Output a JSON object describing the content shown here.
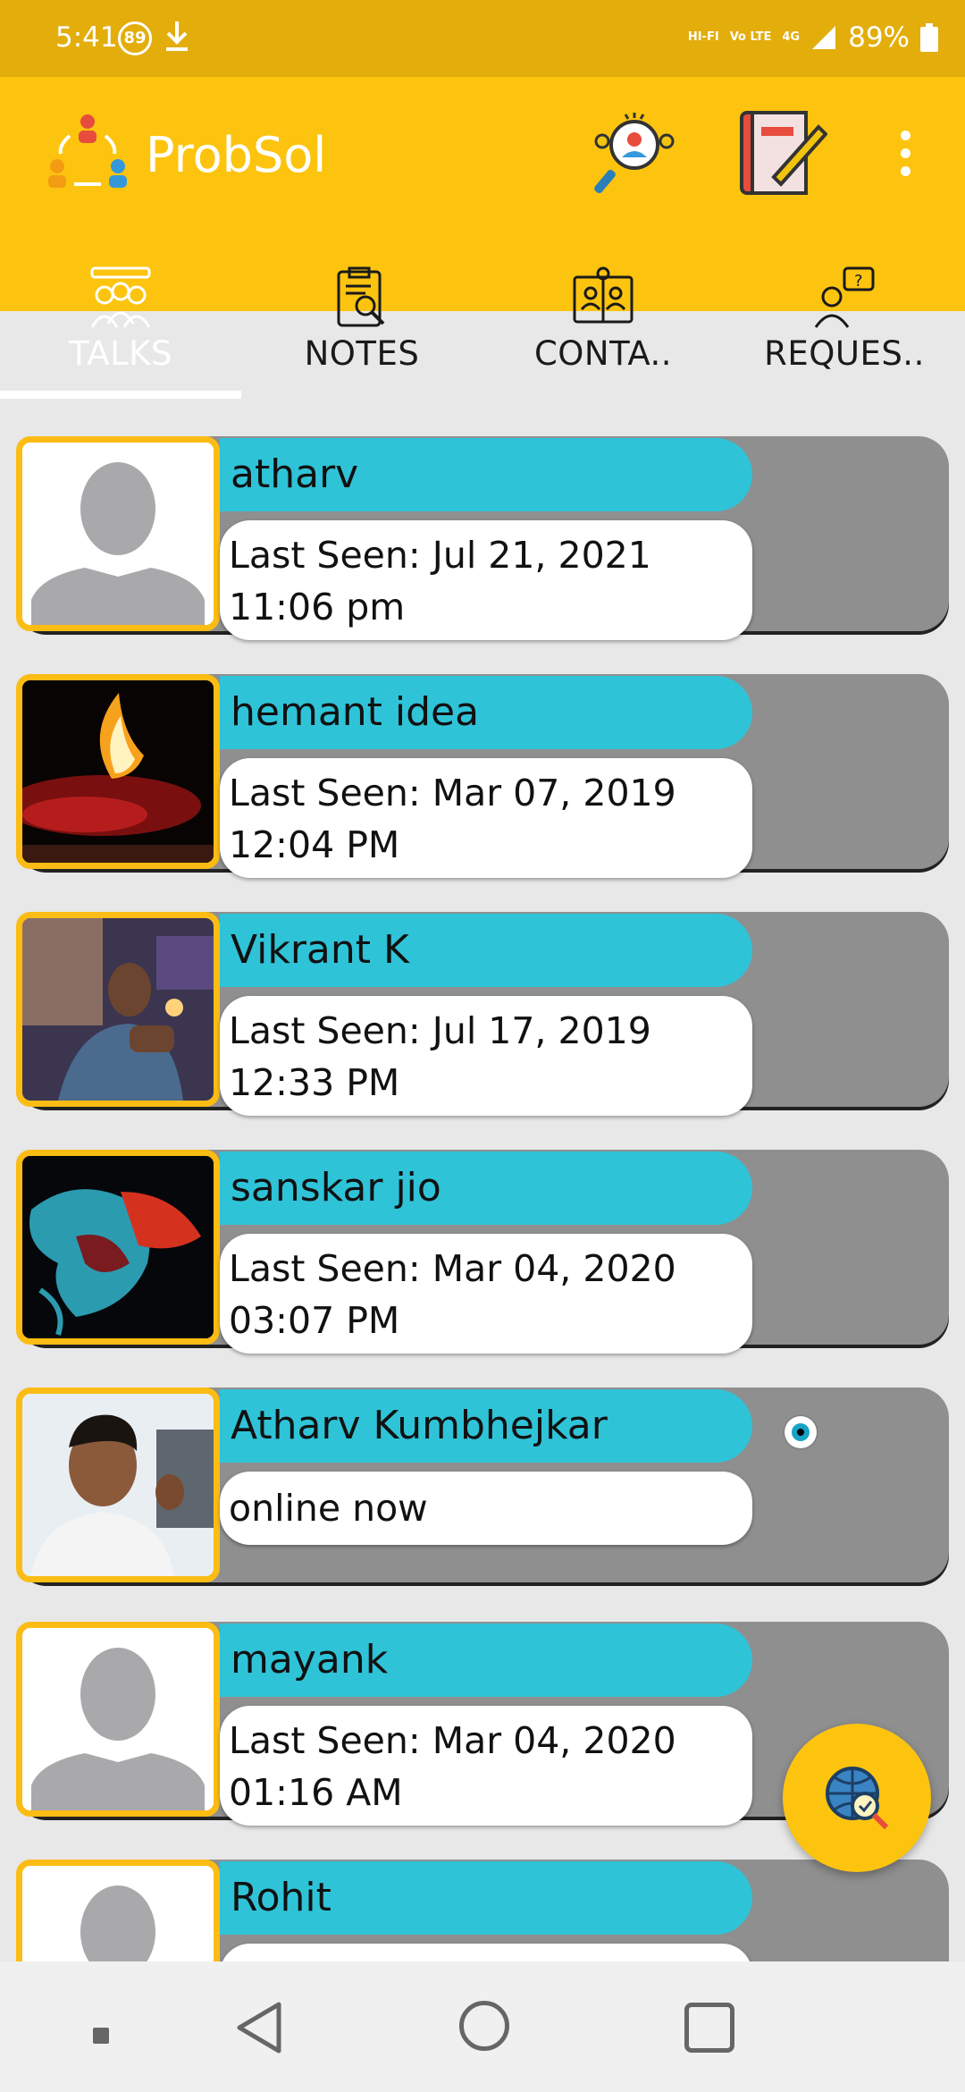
{
  "status_bar": {
    "time": "5:41",
    "notif_badge": "89",
    "hd_label": "HI-FI",
    "volte_label": "Vo LTE",
    "network_label": "4G",
    "battery": "89%"
  },
  "app": {
    "title": "ProbSol",
    "icons": [
      "team-logo-icon",
      "search-user-icon",
      "notes-edit-icon",
      "more-vert-icon"
    ],
    "tabs": [
      {
        "label": "TALKS",
        "active": true,
        "icon": "group-icon"
      },
      {
        "label": "NOTES",
        "active": false,
        "icon": "clipboard-search-icon"
      },
      {
        "label": "CONTA..",
        "active": false,
        "icon": "contacts-book-icon"
      },
      {
        "label": "REQUES..",
        "active": false,
        "icon": "person-question-icon"
      }
    ]
  },
  "chats": [
    {
      "name": "atharv",
      "status": "Last Seen: Jul 21, 2021 11:06 pm",
      "line1": "Last Seen: Jul 21, 2021",
      "line2": "11:06 pm",
      "avatar": "placeholder"
    },
    {
      "name": "hemant idea",
      "status": "Last Seen: Mar 07, 2019 12:04 PM",
      "line1": "Last Seen: Mar 07, 2019",
      "line2": "12:04 PM",
      "avatar": "diya-lamp"
    },
    {
      "name": "Vikrant K",
      "status": "Last Seen: Jul 17, 2019 12:33 PM",
      "line1": "Last Seen: Jul 17, 2019",
      "line2": "12:33 PM",
      "avatar": "man-photo"
    },
    {
      "name": "sanskar jio",
      "status": "Last Seen: Mar 04, 2020 03:07 PM",
      "line1": "Last Seen: Mar 04, 2020",
      "line2": "03:07 PM",
      "avatar": "paint-splash"
    },
    {
      "name": "Atharv Kumbhejkar",
      "status": "online now",
      "line1": "online now",
      "line2": "",
      "avatar": "selfie",
      "online": true
    },
    {
      "name": "mayank",
      "status": "Last Seen: Mar 04, 2020 01:16 AM",
      "line1": "Last Seen: Mar 04, 2020",
      "line2": "01:16 AM",
      "avatar": "placeholder"
    },
    {
      "name": "Rohit",
      "status": "",
      "line1": "",
      "line2": "",
      "avatar": "placeholder"
    }
  ],
  "colors": {
    "status_bar": "#e3ad0b",
    "app_bar": "#fdc40f",
    "name_pill": "#2fc3d8",
    "card_bg": "#8f8f8f",
    "avatar_border": "#fbbc14"
  },
  "fab": {
    "icon": "globe-search-icon"
  }
}
